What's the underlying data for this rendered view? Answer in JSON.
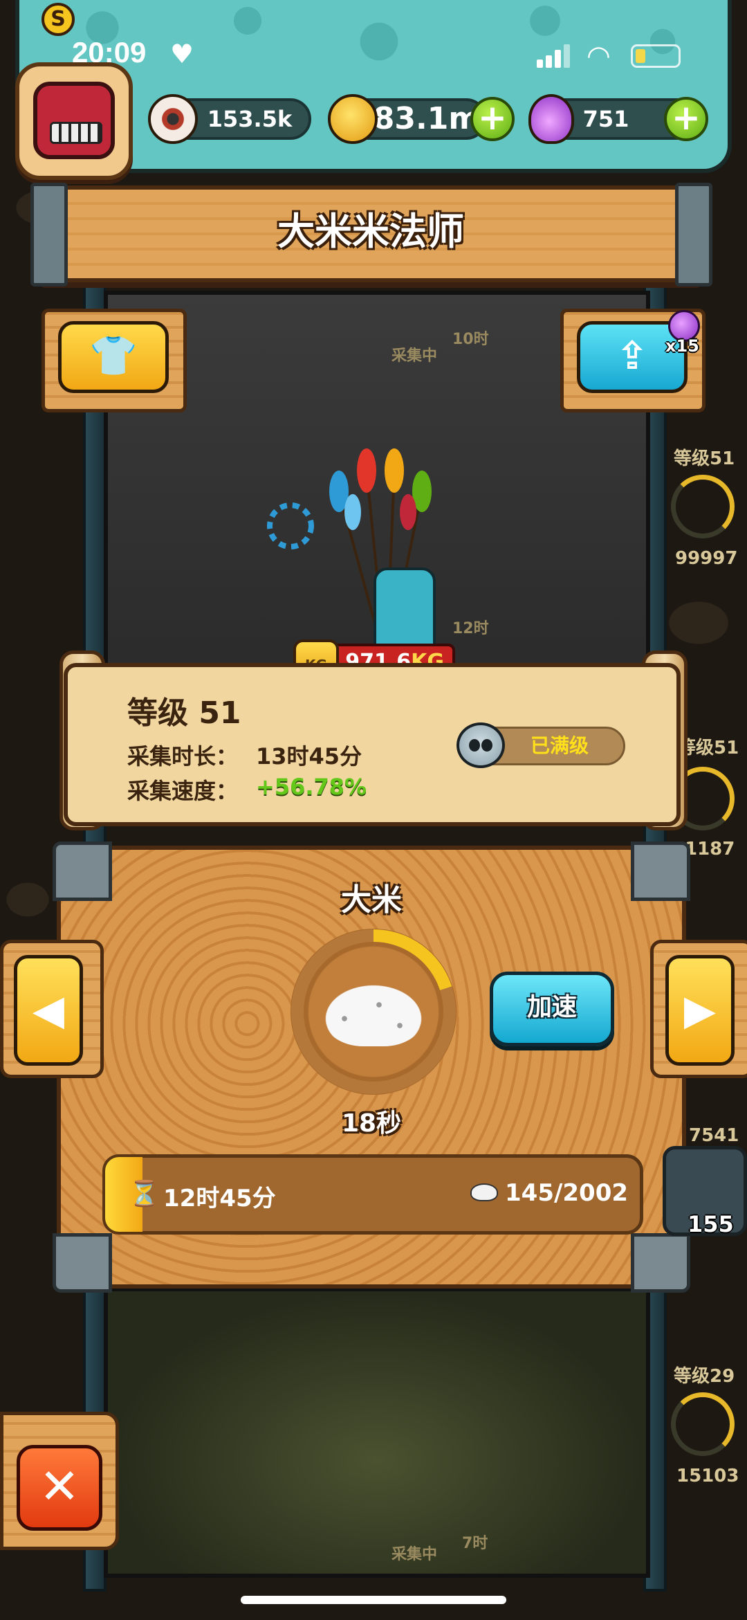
{
  "status_bar": {
    "time": "20:09"
  },
  "resources": {
    "eyeball": {
      "value": "153.5k",
      "icon": "eyeball-icon"
    },
    "coins": {
      "value": "83.1m",
      "icon": "coin-icon"
    },
    "potion": {
      "value": "751",
      "icon": "potion-icon"
    },
    "plus_symbol": "+"
  },
  "avatar": {
    "rank": "S"
  },
  "title": "大米米法师",
  "share": {
    "potion_count": "x15"
  },
  "character": {
    "weight_value": "971.6",
    "weight_unit": "KG",
    "kg_icon_text": "KG"
  },
  "info": {
    "level": "等级 51",
    "duration_label": "采集时长：",
    "duration_value": "13时45分",
    "speed_label": "采集速度：",
    "speed_value": "+56.78%",
    "maxed_label": "已满级"
  },
  "panel": {
    "resource_name": "大米",
    "cycle_progress": 0.2,
    "timer": "18秒",
    "speedup_label": "加速",
    "bar_time": "12时45分",
    "bar_count": "145/2002",
    "bar_fill": 0.07
  },
  "background_labels": {
    "collecting_1": "采集中",
    "collecting_1_time": "10时",
    "collecting_2_time": "12时",
    "collecting_3": "采集中",
    "collecting_3_time": "7时"
  },
  "sidebar": [
    {
      "level": "等级51",
      "count": "99997"
    },
    {
      "level": "等级51",
      "count": "1187"
    },
    {
      "level": "",
      "count": "7541"
    },
    {
      "level": "等级29",
      "count": "15103"
    }
  ],
  "trap": {
    "count": "155"
  },
  "colors": {
    "accent_teal": "#63c6c2",
    "wood": "#e0a45a",
    "speed_green": "#63c81a",
    "maxed_yellow": "#ffe01a",
    "ring_gold": "#f5c41e"
  }
}
